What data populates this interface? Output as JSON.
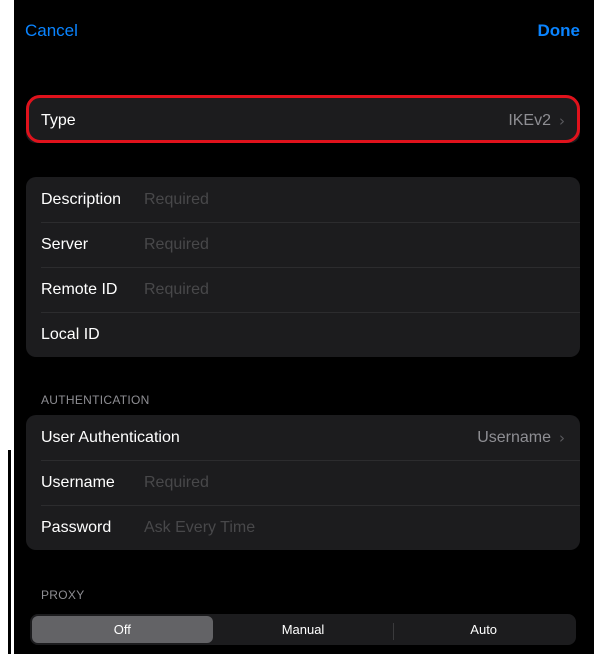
{
  "nav": {
    "cancel_label": "Cancel",
    "done_label": "Done"
  },
  "type_row": {
    "label": "Type",
    "value": "IKEv2",
    "chevron": "›",
    "highlight_color": "#e0121c"
  },
  "fields": {
    "description": {
      "label": "Description",
      "placeholder": "Required"
    },
    "server": {
      "label": "Server",
      "placeholder": "Required"
    },
    "remote_id": {
      "label": "Remote ID",
      "placeholder": "Required"
    },
    "local_id": {
      "label": "Local ID",
      "placeholder": ""
    }
  },
  "authentication": {
    "header": "AUTHENTICATION",
    "user_auth": {
      "label": "User Authentication",
      "value": "Username",
      "chevron": "›"
    },
    "username": {
      "label": "Username",
      "placeholder": "Required"
    },
    "password": {
      "label": "Password",
      "placeholder": "Ask Every Time"
    }
  },
  "proxy": {
    "header": "PROXY",
    "options": [
      "Off",
      "Manual",
      "Auto"
    ],
    "selected": "Off"
  },
  "colors": {
    "accent": "#0a84ff",
    "background": "#000000",
    "group_background": "#1c1c1e",
    "placeholder": "#48484a",
    "secondary_text": "#8e8e93"
  },
  "icons": {
    "chevron": "chevron-right-icon"
  }
}
